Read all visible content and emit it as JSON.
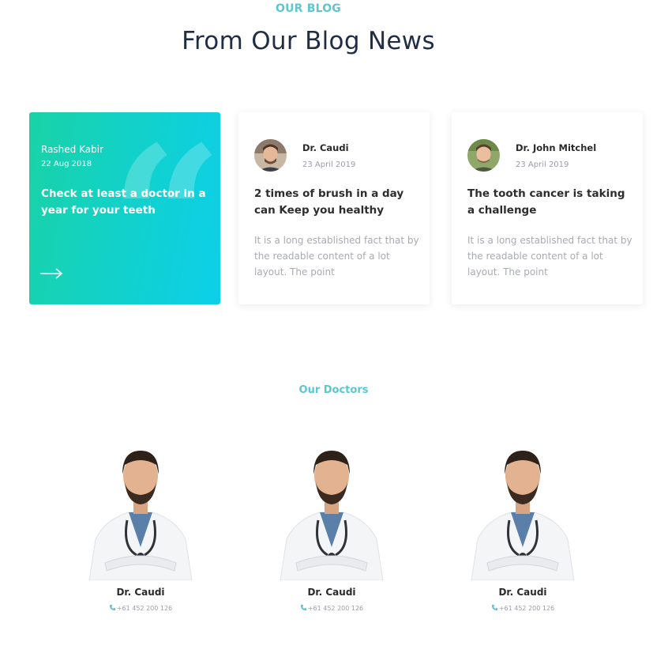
{
  "blog": {
    "eyebrow": "OUR BLOG",
    "title": "From Our Blog News",
    "featured": {
      "author": "Rashed Kabir",
      "date": "22 Aug 2018",
      "title": "Check at least a doctor in a year for your teeth",
      "quote_glyph": "“",
      "arrow_icon": "arrow-right-icon",
      "gradient_start": "#19d3a6",
      "gradient_end": "#0cd0ea"
    },
    "posts": [
      {
        "author": "Dr. Caudi",
        "date": "23 April 2019",
        "title": "2 times of brush in a day can Keep you healthy",
        "excerpt": "It is a long established fact that by the readable content of a lot layout. The point"
      },
      {
        "author": "Dr. John Mitchel",
        "date": "23 April 2019",
        "title": "The tooth cancer is taking a challenge",
        "excerpt": "It is a long established fact that by the readable content of a lot layout. The point"
      }
    ]
  },
  "doctors": {
    "heading": "Our Doctors",
    "items": [
      {
        "name": "Dr. Caudi",
        "phone": "+61 452 200 126"
      },
      {
        "name": "Dr. Caudi",
        "phone": "+61 452 200 126"
      },
      {
        "name": "Dr. Caudi",
        "phone": "+61 452 200 126"
      }
    ]
  },
  "colors": {
    "accent": "#5bc8cf",
    "heading": "#1f2d45",
    "muted": "#a7abb2"
  }
}
